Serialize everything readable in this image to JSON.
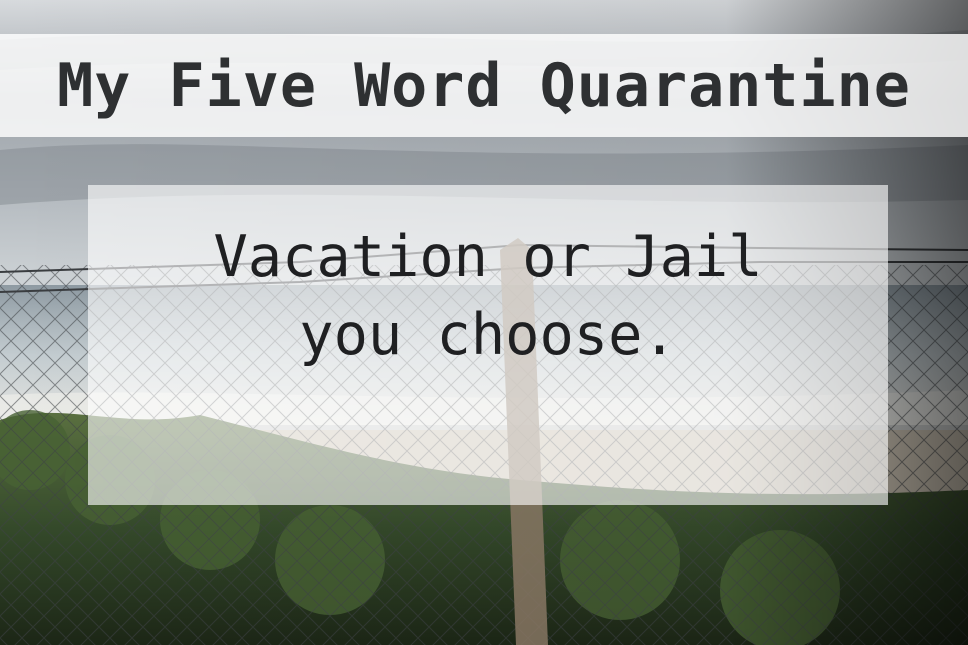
{
  "title": "My Five Word Quarantine",
  "caption": {
    "line1": "Vacation or Jail",
    "line2": "you choose."
  },
  "colors": {
    "title_text": "#2e3032",
    "caption_text": "#1f2022",
    "sky": "#c9ced3",
    "sea": "#aab6bd",
    "grass": "#3f5a2c"
  }
}
